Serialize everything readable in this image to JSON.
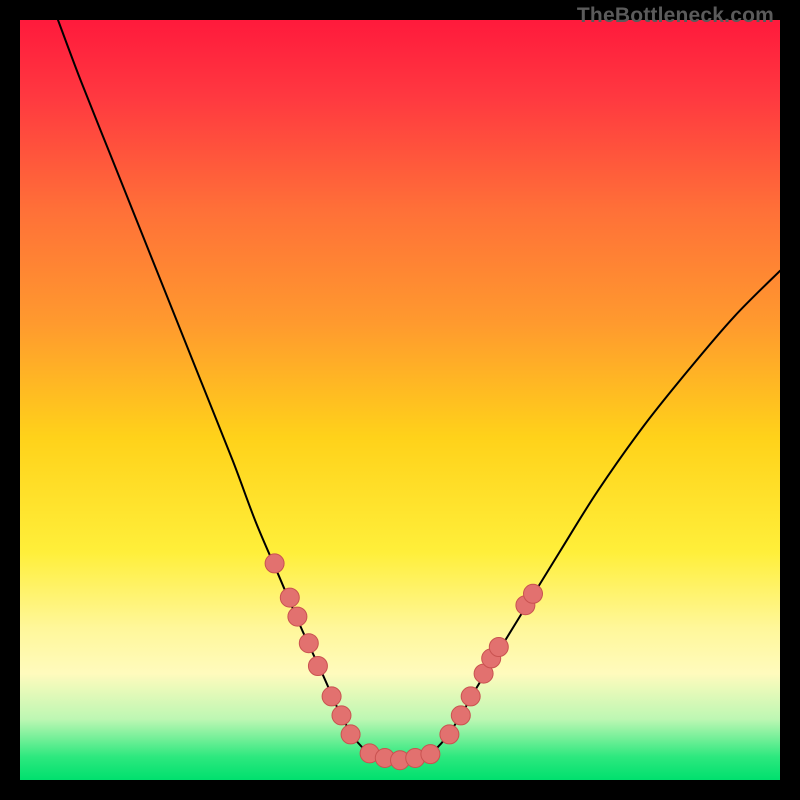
{
  "watermark": "TheBottleneck.com",
  "chart_data": {
    "type": "line",
    "title": "",
    "xlabel": "",
    "ylabel": "",
    "xlim": [
      0,
      100
    ],
    "ylim": [
      0,
      100
    ],
    "background_gradient": {
      "stops": [
        {
          "offset": 0.0,
          "color": "#ff1a3c"
        },
        {
          "offset": 0.1,
          "color": "#ff3840"
        },
        {
          "offset": 0.25,
          "color": "#ff7038"
        },
        {
          "offset": 0.4,
          "color": "#ff9a2e"
        },
        {
          "offset": 0.55,
          "color": "#ffd21a"
        },
        {
          "offset": 0.7,
          "color": "#ffef3a"
        },
        {
          "offset": 0.8,
          "color": "#fff79a"
        },
        {
          "offset": 0.86,
          "color": "#fffbbd"
        },
        {
          "offset": 0.92,
          "color": "#bdf7b3"
        },
        {
          "offset": 0.97,
          "color": "#2ce87e"
        },
        {
          "offset": 1.0,
          "color": "#00e06e"
        }
      ]
    },
    "series": [
      {
        "name": "bottleneck-curve",
        "stroke": "#000000",
        "stroke_width": 2,
        "points": [
          {
            "x": 5.0,
            "y": 100.0
          },
          {
            "x": 8.0,
            "y": 92.0
          },
          {
            "x": 12.0,
            "y": 82.0
          },
          {
            "x": 16.0,
            "y": 72.0
          },
          {
            "x": 20.0,
            "y": 62.0
          },
          {
            "x": 24.0,
            "y": 52.0
          },
          {
            "x": 28.0,
            "y": 42.0
          },
          {
            "x": 31.0,
            "y": 34.0
          },
          {
            "x": 34.0,
            "y": 27.0
          },
          {
            "x": 37.0,
            "y": 20.0
          },
          {
            "x": 40.0,
            "y": 13.5
          },
          {
            "x": 42.0,
            "y": 9.0
          },
          {
            "x": 44.0,
            "y": 5.5
          },
          {
            "x": 46.0,
            "y": 3.5
          },
          {
            "x": 48.0,
            "y": 2.7
          },
          {
            "x": 50.0,
            "y": 2.6
          },
          {
            "x": 52.0,
            "y": 2.7
          },
          {
            "x": 54.0,
            "y": 3.5
          },
          {
            "x": 56.0,
            "y": 5.5
          },
          {
            "x": 58.0,
            "y": 8.5
          },
          {
            "x": 60.0,
            "y": 12.0
          },
          {
            "x": 63.0,
            "y": 17.0
          },
          {
            "x": 67.0,
            "y": 23.5
          },
          {
            "x": 71.0,
            "y": 30.0
          },
          {
            "x": 76.0,
            "y": 38.0
          },
          {
            "x": 82.0,
            "y": 46.5
          },
          {
            "x": 88.0,
            "y": 54.0
          },
          {
            "x": 94.0,
            "y": 61.0
          },
          {
            "x": 100.0,
            "y": 67.0
          }
        ]
      }
    ],
    "scatter": [
      {
        "name": "left-cluster",
        "fill": "#e2716f",
        "stroke": "#c95250",
        "points": [
          {
            "x": 33.5,
            "y": 28.5
          },
          {
            "x": 35.5,
            "y": 24.0
          },
          {
            "x": 36.5,
            "y": 21.5
          },
          {
            "x": 38.0,
            "y": 18.0
          },
          {
            "x": 39.2,
            "y": 15.0
          },
          {
            "x": 41.0,
            "y": 11.0
          },
          {
            "x": 42.3,
            "y": 8.5
          },
          {
            "x": 43.5,
            "y": 6.0
          }
        ]
      },
      {
        "name": "bottom-run",
        "fill": "#e2716f",
        "stroke": "#c95250",
        "points": [
          {
            "x": 46.0,
            "y": 3.5
          },
          {
            "x": 48.0,
            "y": 2.9
          },
          {
            "x": 50.0,
            "y": 2.6
          },
          {
            "x": 52.0,
            "y": 2.9
          },
          {
            "x": 54.0,
            "y": 3.4
          }
        ]
      },
      {
        "name": "right-cluster",
        "fill": "#e2716f",
        "stroke": "#c95250",
        "points": [
          {
            "x": 56.5,
            "y": 6.0
          },
          {
            "x": 58.0,
            "y": 8.5
          },
          {
            "x": 59.3,
            "y": 11.0
          },
          {
            "x": 61.0,
            "y": 14.0
          },
          {
            "x": 62.0,
            "y": 16.0
          },
          {
            "x": 63.0,
            "y": 17.5
          },
          {
            "x": 66.5,
            "y": 23.0
          },
          {
            "x": 67.5,
            "y": 24.5
          }
        ]
      }
    ]
  }
}
